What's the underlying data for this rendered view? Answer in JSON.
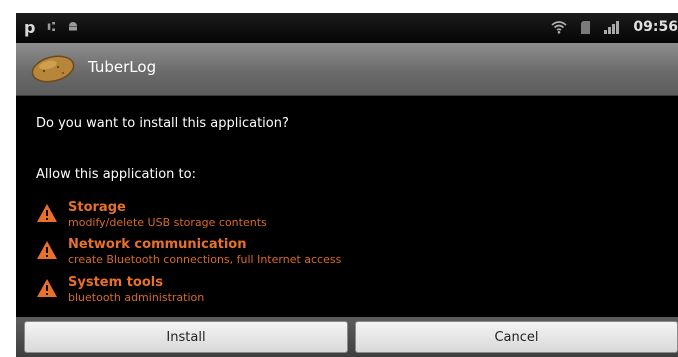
{
  "status_bar": {
    "left_letter": "p",
    "time": "09:56",
    "icons": [
      "p-app-icon",
      "usb-icon",
      "android-icon",
      "wifi-icon",
      "sd-card-icon",
      "signal-icon"
    ]
  },
  "title_bar": {
    "app_name": "TuberLog",
    "icon": "potato-icon"
  },
  "dialog": {
    "question": "Do you want to install this application?",
    "allow_heading": "Allow this application to:",
    "permissions": [
      {
        "title": "Storage",
        "description": "modify/delete USB storage contents",
        "icon": "warning-icon"
      },
      {
        "title": "Network communication",
        "description": "create Bluetooth connections, full Internet access",
        "icon": "warning-icon"
      },
      {
        "title": "System tools",
        "description": "bluetooth administration",
        "icon": "warning-icon"
      }
    ]
  },
  "buttons": {
    "install_label": "Install",
    "cancel_label": "Cancel"
  },
  "colors": {
    "permission_accent": "#e8702a",
    "background": "#000000",
    "title_bar": "#7a7a7a"
  }
}
